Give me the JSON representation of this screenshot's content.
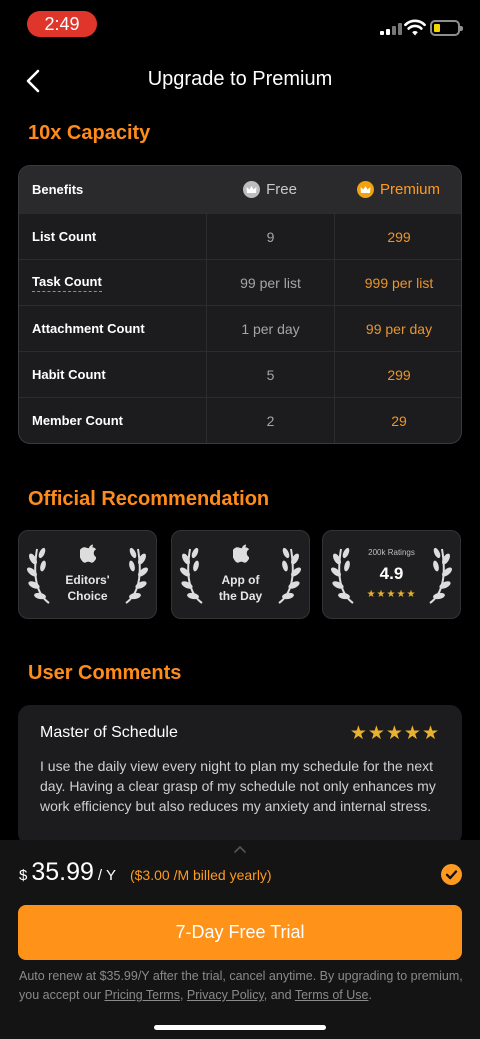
{
  "status_bar": {
    "time": "2:49",
    "battery_level": 0.2,
    "battery_color": "#f1d600",
    "time_pill_color": "#e0352b"
  },
  "nav": {
    "back_icon": "chevron-left-icon",
    "title": "Upgrade to Premium"
  },
  "sections": {
    "capacity": "10x Capacity",
    "recommendation": "Official Recommendation",
    "comments": "User Comments"
  },
  "table": {
    "headers": {
      "benefits": "Benefits",
      "free": "Free",
      "premium": "Premium"
    },
    "rows": [
      {
        "label": "List Count",
        "free": "9",
        "premium": "299"
      },
      {
        "label": "Task Count",
        "free": "99 per list",
        "premium": "999 per list"
      },
      {
        "label": "Attachment Count",
        "free": "1 per day",
        "premium": "99 per day"
      },
      {
        "label": "Habit Count",
        "free": "5",
        "premium": "299"
      },
      {
        "label": "Member Count",
        "free": "2",
        "premium": "29"
      }
    ]
  },
  "badges": [
    {
      "icon": "apple-icon",
      "line1": "Editors'",
      "line2": "Choice"
    },
    {
      "icon": "apple-icon",
      "line1": "App of",
      "line2": "the Day"
    },
    {
      "caption": "200k Ratings",
      "rating": "4.9",
      "stars": "★★★★★"
    }
  ],
  "comment": {
    "title": "Master of Schedule",
    "stars": "★★★★★",
    "body": "I use the daily view every night to plan my schedule for the next day. Having a clear grasp of my schedule not only enhances my work efficiency but also reduces my anxiety and internal stress."
  },
  "purchase": {
    "currency": "$",
    "amount": "35.99",
    "period": "/ Y",
    "billed": "($3.00 /M billed yearly)",
    "cta": "7-Day Free Trial",
    "terms_prefix": "Auto renew at $35.99/Y after the trial, cancel anytime. By upgrading to premium, you accept our ",
    "pricing_terms": "Pricing Terms",
    "sep1": ", ",
    "privacy_policy": "Privacy Policy",
    "sep2": ", and ",
    "terms_of_use": "Terms of Use",
    "terms_suffix": "."
  },
  "colors": {
    "accent": "#ff9319",
    "premium_text": "#e8962e",
    "gold_stars": "#e8b12f"
  }
}
